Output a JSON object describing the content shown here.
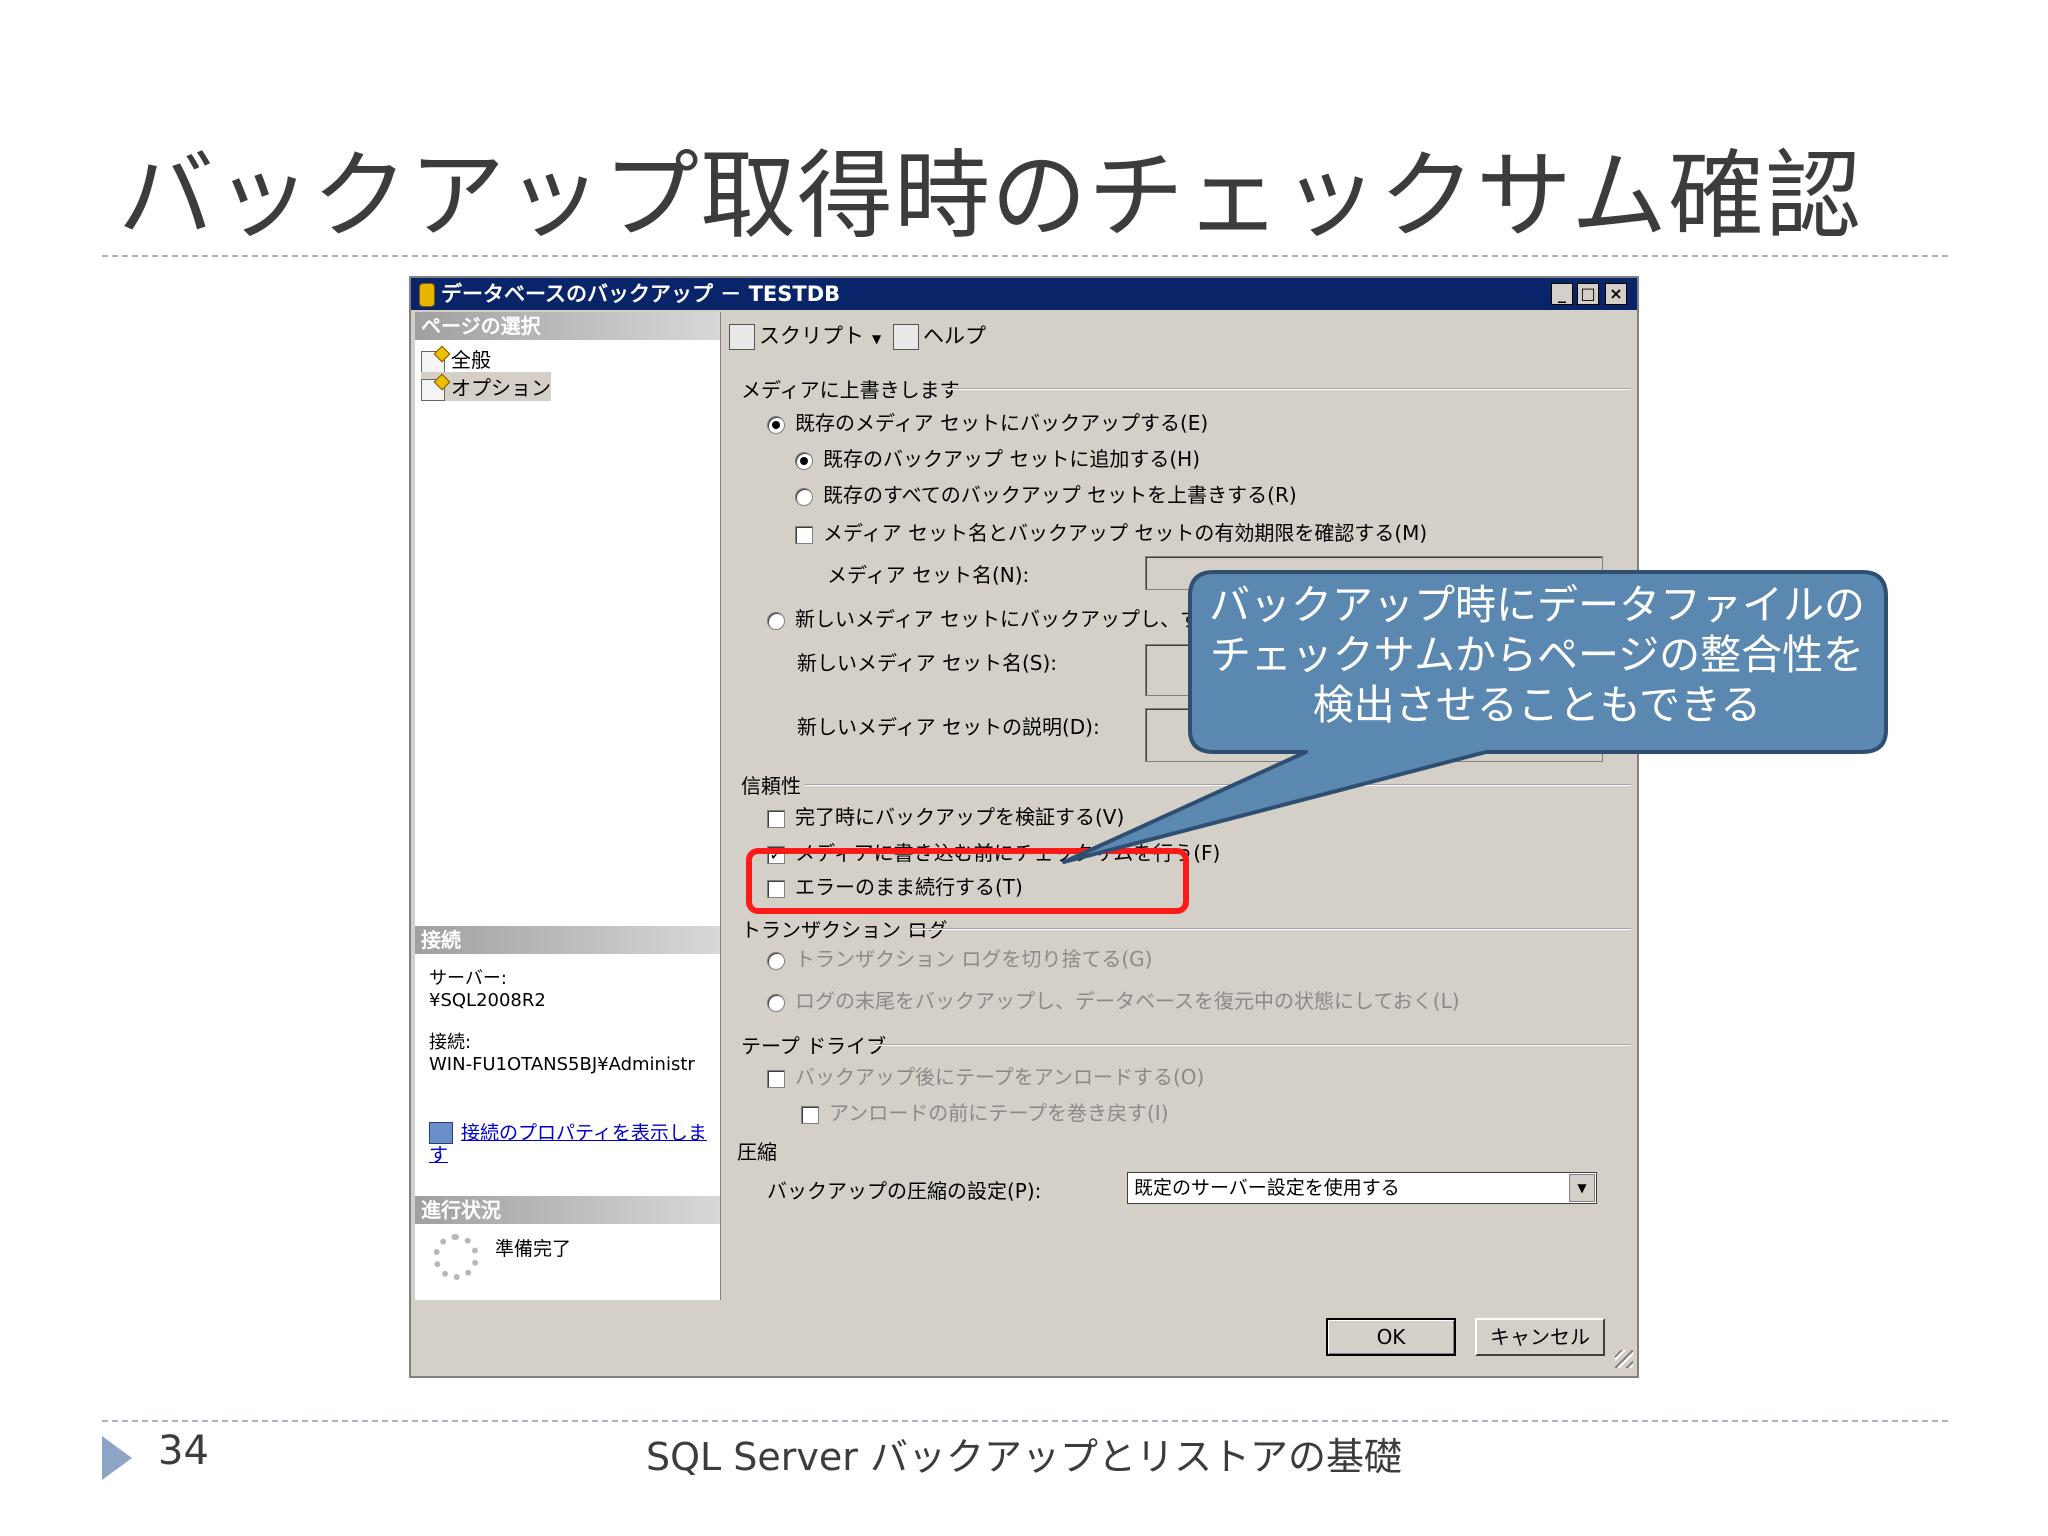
{
  "slide": {
    "title": "バックアップ取得時のチェックサム確認",
    "page_number": "34",
    "footer_title": "SQL Server バックアップとリストアの基礎"
  },
  "window": {
    "title": "データベースのバックアップ － TESTDB",
    "controls": {
      "minimize": "_",
      "maximize": "□",
      "close": "×"
    }
  },
  "left_pane": {
    "page_select_header": "ページの選択",
    "pages": [
      "全般",
      "オプション"
    ],
    "connection_header": "接続",
    "server_label": "サーバー:",
    "server_value": "¥SQL2008R2",
    "connection_label": "接続:",
    "connection_value": "WIN-FU1OTANS5BJ¥Administr",
    "connection_link": "接続のプロパティを表示します",
    "progress_header": "進行状況",
    "progress_status": "準備完了"
  },
  "toolbar": {
    "script": "スクリプト",
    "help": "ヘルプ"
  },
  "options": {
    "overwrite_media_group": "メディアに上書きします",
    "backup_existing_set": "既存のメディア セットにバックアップする(E)",
    "append_existing": "既存のバックアップ セットに追加する(H)",
    "overwrite_all": "既存のすべてのバックアップ セットを上書きする(R)",
    "check_media_expiry": "メディア セット名とバックアップ セットの有効期限を確認する(M)",
    "media_set_name_label": "メディア セット名(N):",
    "backup_new_set": "新しいメディア セットにバックアップし、すべての既",
    "new_media_set_name_label": "新しいメディア セット名(S):",
    "new_media_set_desc_label": "新しいメディア セットの説明(D):",
    "reliability_group": "信頼性",
    "verify_backup": "完了時にバックアップを検証する(V)",
    "checksum_before_write": "メディアに書き込む前にチェックサムを行う(F)",
    "continue_on_error": "エラーのまま続行する(T)",
    "transaction_log_group": "トランザクション ログ",
    "truncate_log": "トランザクション ログを切り捨てる(G)",
    "backup_tail_log": "ログの末尾をバックアップし、データベースを復元中の状態にしておく(L)",
    "tape_drive_group": "テープ ドライブ",
    "unload_tape": "バックアップ後にテープをアンロードする(O)",
    "rewind_tape": "アンロードの前にテープを巻き戻す(I)",
    "compression_group": "圧縮",
    "compression_label": "バックアップの圧縮の設定(P):",
    "compression_value": "既定のサーバー設定を使用する"
  },
  "buttons": {
    "ok": "OK",
    "cancel": "キャンセル"
  },
  "callout": {
    "line1": "バックアップ時にデータファイルの",
    "line2": "チェックサムからページの整合性を",
    "line3": "検出させることもできる"
  },
  "colors": {
    "callout_fill": "#5b88b0",
    "callout_border": "#2f4f72",
    "highlight": "#ff1a1a",
    "titlebar": "#0a246a"
  }
}
